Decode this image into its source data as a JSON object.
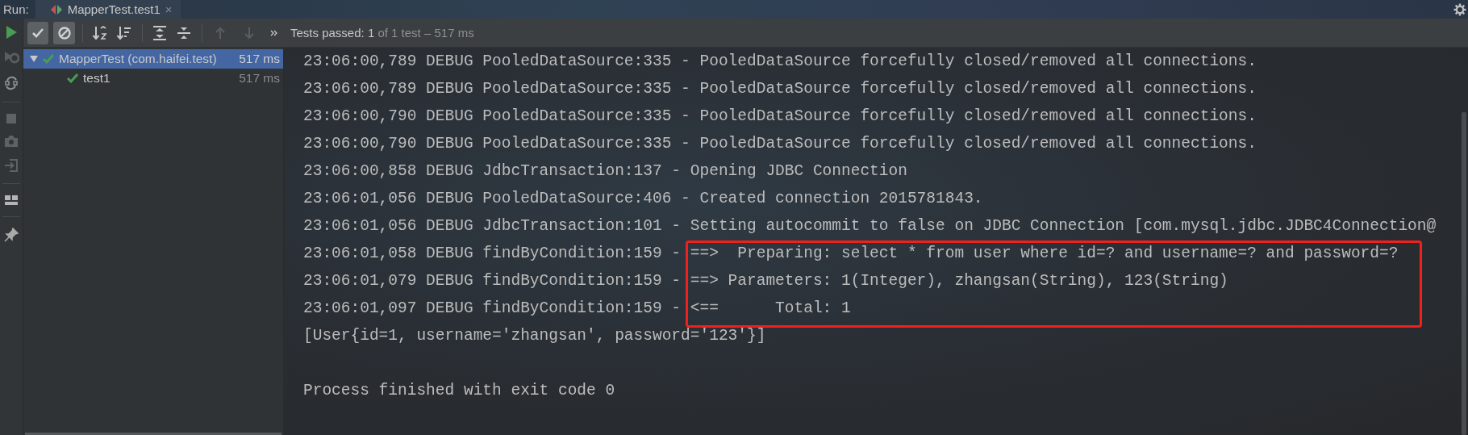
{
  "run_bar": {
    "label": "Run:",
    "tabs": [
      {
        "title": "MapperTest.test1",
        "close": "×",
        "selected": true
      }
    ]
  },
  "toolbar": {
    "filters": [
      {
        "kind": "passed",
        "on": true
      },
      {
        "kind": "ignored",
        "on": true
      }
    ],
    "navigation": [
      {
        "kind": "previous",
        "disabled": true
      },
      {
        "kind": "next",
        "disabled": true
      }
    ]
  },
  "status": {
    "passed": "Tests passed: 1",
    "detail": "of 1 test – 517 ms"
  },
  "tests": [
    {
      "name": "MapperTest (com.haifei.test)",
      "time": "517 ms",
      "passed": true,
      "selected": true,
      "expanded": true,
      "children": [
        {
          "name": "test1",
          "time": "517 ms",
          "passed": true,
          "selected": false
        }
      ]
    }
  ],
  "console": {
    "lines": [
      {
        "kind": "log",
        "text": "23:06:00,789 DEBUG PooledDataSource:335 - PooledDataSource forcefully closed/removed all connections.",
        "boxed": false
      },
      {
        "kind": "log",
        "text": "23:06:00,789 DEBUG PooledDataSource:335 - PooledDataSource forcefully closed/removed all connections.",
        "boxed": false
      },
      {
        "kind": "log",
        "text": "23:06:00,790 DEBUG PooledDataSource:335 - PooledDataSource forcefully closed/removed all connections.",
        "boxed": false
      },
      {
        "kind": "log",
        "text": "23:06:00,790 DEBUG PooledDataSource:335 - PooledDataSource forcefully closed/removed all connections.",
        "boxed": false
      },
      {
        "kind": "log",
        "text": "23:06:00,858 DEBUG JdbcTransaction:137 - Opening JDBC Connection",
        "boxed": false
      },
      {
        "kind": "log",
        "text": "23:06:01,056 DEBUG PooledDataSource:406 - Created connection 2015781843.",
        "boxed": false
      },
      {
        "kind": "log",
        "text": "23:06:01,056 DEBUG JdbcTransaction:101 - Setting autocommit to false on JDBC Connection [com.mysql.jdbc.JDBC4Connection@",
        "boxed": false
      },
      {
        "kind": "log",
        "text": "23:06:01,058 DEBUG findByCondition:159 - ==>  Preparing: select * from user where id=? and username=? and password=?",
        "boxed": true
      },
      {
        "kind": "log",
        "text": "23:06:01,079 DEBUG findByCondition:159 - ==> Parameters: 1(Integer), zhangsan(String), 123(String)",
        "boxed": true
      },
      {
        "kind": "log",
        "text": "23:06:01,097 DEBUG findByCondition:159 - <==      Total: 1",
        "boxed": true
      },
      {
        "kind": "log",
        "text": "[User{id=1, username='zhangsan', password='123'}]",
        "boxed": false
      },
      {
        "kind": "blank"
      },
      {
        "kind": "log",
        "text": "Process finished with exit code 0",
        "boxed": false
      }
    ]
  }
}
